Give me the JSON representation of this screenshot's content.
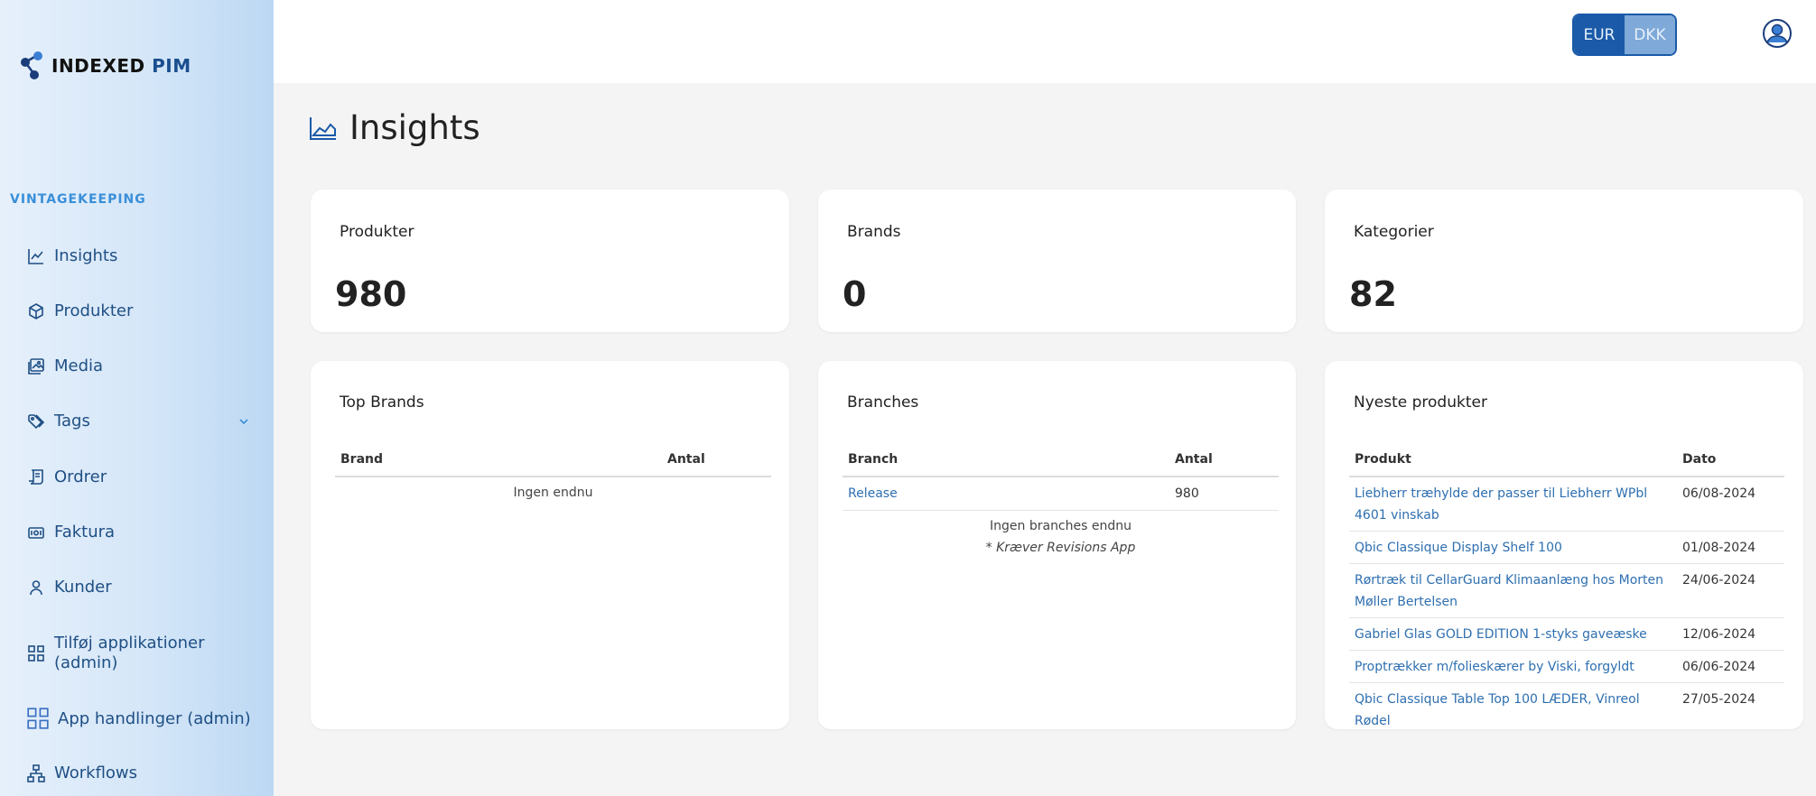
{
  "app": {
    "logo_main": "INDEXED",
    "logo_accent": "PIM",
    "org_label": "VINTAGEKEEPING"
  },
  "sidebar": {
    "items": [
      {
        "label": "Insights",
        "icon": "chart-line-icon"
      },
      {
        "label": "Produkter",
        "icon": "box-icon"
      },
      {
        "label": "Media",
        "icon": "image-icon"
      },
      {
        "label": "Tags",
        "icon": "tag-icon"
      },
      {
        "label": "Ordrer",
        "icon": "receipt-icon"
      },
      {
        "label": "Faktura",
        "icon": "money-icon"
      },
      {
        "label": "Kunder",
        "icon": "user-icon"
      },
      {
        "label": "Tilføj applikationer (admin)",
        "icon": "grid-icon"
      },
      {
        "label": "App handlinger (admin)",
        "icon": "grid-icon"
      },
      {
        "label": "Workflows",
        "icon": "workflow-icon"
      }
    ]
  },
  "topbar": {
    "currency_active": "EUR",
    "currency_inactive": "DKK"
  },
  "page": {
    "title": "Insights"
  },
  "stats": {
    "products": {
      "label": "Produkter",
      "value": "980"
    },
    "brands": {
      "label": "Brands",
      "value": "0"
    },
    "categories": {
      "label": "Kategorier",
      "value": "82"
    }
  },
  "top_brands": {
    "title": "Top Brands",
    "columns": [
      "Brand",
      "Antal"
    ],
    "empty": "Ingen endnu"
  },
  "branches": {
    "title": "Branches",
    "columns": [
      "Branch",
      "Antal"
    ],
    "rows": [
      {
        "name": "Release",
        "count": "980"
      }
    ],
    "empty": "Ingen branches endnu",
    "note": "* Kræver Revisions App"
  },
  "newest": {
    "title": "Nyeste produkter",
    "columns": [
      "Produkt",
      "Dato"
    ],
    "rows": [
      {
        "name": "Liebherr træhylde der passer til Liebherr WPbl 4601 vinskab",
        "date": "06/08-2024"
      },
      {
        "name": "Qbic Classique Display Shelf 100",
        "date": "01/08-2024"
      },
      {
        "name": "Rørtræk til CellarGuard Klimaanlæng hos Morten Møller Bertelsen",
        "date": "24/06-2024"
      },
      {
        "name": "Gabriel Glas GOLD EDITION 1-styks gaveæske",
        "date": "12/06-2024"
      },
      {
        "name": "Proptrækker m/folieskærer by Viski, forgyldt",
        "date": "06/06-2024"
      },
      {
        "name": "Qbic Classique Table Top 100 LÆDER, Vinreol Rødel",
        "date": "27/05-2024"
      }
    ]
  },
  "colors": {
    "accent": "#1a5aa8",
    "link": "#2e6fb0",
    "nav_text": "#1f4f84"
  }
}
